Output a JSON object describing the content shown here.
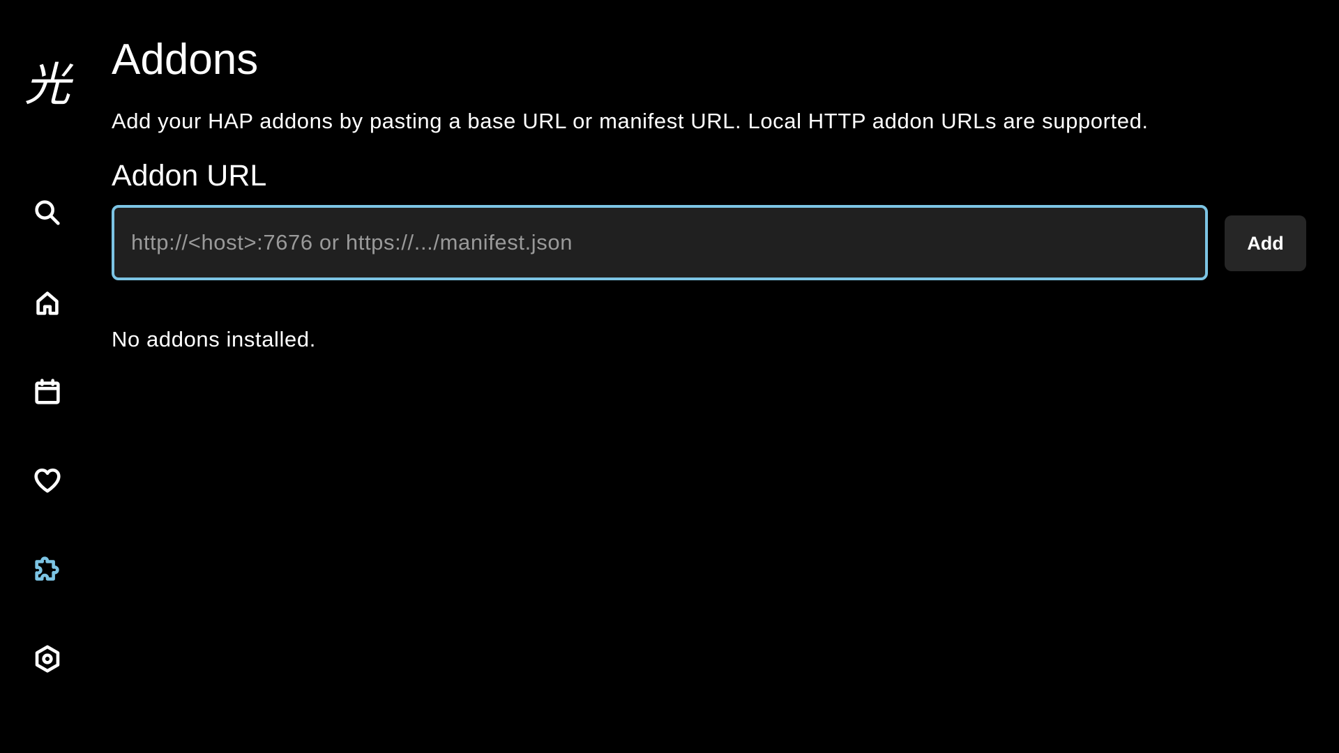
{
  "sidebar": {
    "logo_glyph": "光",
    "items": [
      {
        "name": "search",
        "icon": "search-icon",
        "active": false
      },
      {
        "name": "home",
        "icon": "home-icon",
        "active": false
      },
      {
        "name": "calendar",
        "icon": "calendar-icon",
        "active": false
      },
      {
        "name": "favorites",
        "icon": "heart-icon",
        "active": false
      },
      {
        "name": "addons",
        "icon": "puzzle-icon",
        "active": true
      },
      {
        "name": "settings",
        "icon": "settings-icon",
        "active": false
      }
    ],
    "active_color": "#7cc4e4",
    "icon_color": "#ffffff"
  },
  "main": {
    "title": "Addons",
    "description": "Add your HAP addons by pasting a base URL or manifest URL. Local HTTP addon URLs are supported.",
    "field_label": "Addon URL",
    "url_input": {
      "value": "",
      "placeholder": "http://<host>:7676 or https://.../manifest.json"
    },
    "add_button_label": "Add",
    "empty_message": "No addons installed."
  },
  "colors": {
    "background": "#000000",
    "input_background": "#202020",
    "input_border": "#7cc4e4",
    "button_background": "#262626",
    "placeholder": "#9a9a9a"
  }
}
